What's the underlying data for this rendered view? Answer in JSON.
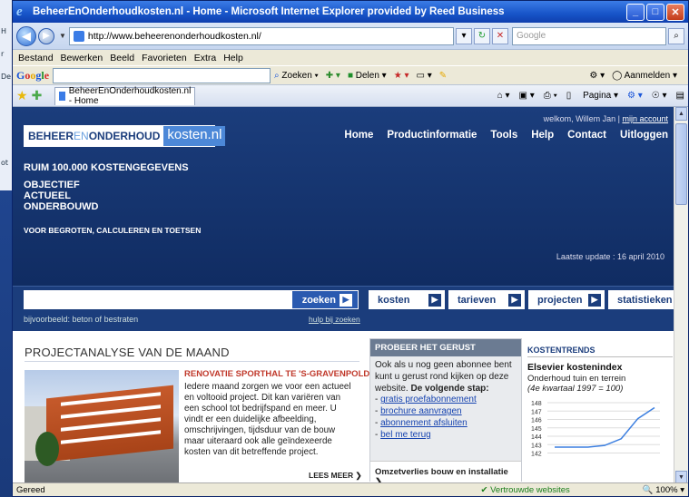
{
  "window": {
    "title": "BeheerEnOnderhoudkosten.nl - Home - Microsoft Internet Explorer provided by Reed Business"
  },
  "address": {
    "url": "http://www.beheerenonderhoudkosten.nl/",
    "search_placeholder": "Google"
  },
  "menu": [
    "Bestand",
    "Bewerken",
    "Beeld",
    "Favorieten",
    "Extra",
    "Help"
  ],
  "google_toolbar": {
    "logo": [
      "G",
      "o",
      "o",
      "g",
      "l",
      "e"
    ],
    "zoeken": "Zoeken",
    "delen": "Delen",
    "aanmelden": "Aanmelden"
  },
  "tab": {
    "label": "BeheerEnOnderhoudkosten.nl - Home"
  },
  "cmdbar": {
    "pagina": "Pagina"
  },
  "site": {
    "logo_a": "BEHEER",
    "logo_en": "EN",
    "logo_b": "ONDERHOUD",
    "logo_c": "kosten.nl",
    "welcome": "welkom, Willem Jan |",
    "account": "mijn account",
    "nav": [
      "Home",
      "Productinformatie",
      "Tools",
      "Help",
      "Contact",
      "Uitloggen"
    ],
    "tagline_main": "RUIM 100.000 KOSTENGEGEVENS",
    "tagline_1": "OBJECTIEF",
    "tagline_2": "ACTUEEL",
    "tagline_3": "ONDERBOUWD",
    "tagline_sub": "VOOR BEGROTEN, CALCULEREN EN TOETSEN",
    "updated": "Laatste update : 16 april 2010"
  },
  "search": {
    "button": "zoeken",
    "example": "bijvoorbeeld: beton of bestraten",
    "help": "hulp bij zoeken",
    "categories": [
      "kosten",
      "tarieven",
      "projecten",
      "statistieken"
    ]
  },
  "project": {
    "section_title": "PROJECTANALYSE VAN DE MAAND",
    "title": "RENOVATIE SPORTHAL TE 'S-GRAVENPOLDER",
    "body": "Iedere maand zorgen we voor een actueel en voltooid project. Dit kan variëren van een school tot bedrijfspand en meer. U vindt er een duidelijke afbeelding, omschrijvingen, tijdsduur van de bouw maar uiteraard ook alle geïndexeerde kosten van dit betreffende project.",
    "more": "LEES MEER"
  },
  "probe": {
    "header": "PROBEER HET GERUST",
    "intro": "Ook als u nog geen abonnee bent kunt u gerust rond kijken op deze website.",
    "next": "De volgende stap:",
    "links": [
      "gratis proefabonnement",
      "brochure aanvragen",
      "abonnement afsluiten",
      "bel me terug"
    ],
    "footer": "Omzetverlies bouw en installatie"
  },
  "trends": {
    "header": "KOSTENTRENDS",
    "title": "Elsevier kostenindex",
    "subtitle": "Onderhoud tuin en terrein",
    "note": "(4e kwartaal 1997 = 100)"
  },
  "chart_data": {
    "type": "line",
    "title": "",
    "ylim": [
      140,
      148
    ],
    "yticks": [
      "148",
      "147",
      "146",
      "145",
      "144",
      "143",
      "142"
    ],
    "series": [
      {
        "values": [
          142.7,
          142.7,
          142.7,
          142.9,
          143.7,
          146.1,
          147.4
        ]
      }
    ]
  },
  "status": {
    "left": "Gereed",
    "trust": "Vertrouwde websites",
    "zoom": "100%"
  }
}
